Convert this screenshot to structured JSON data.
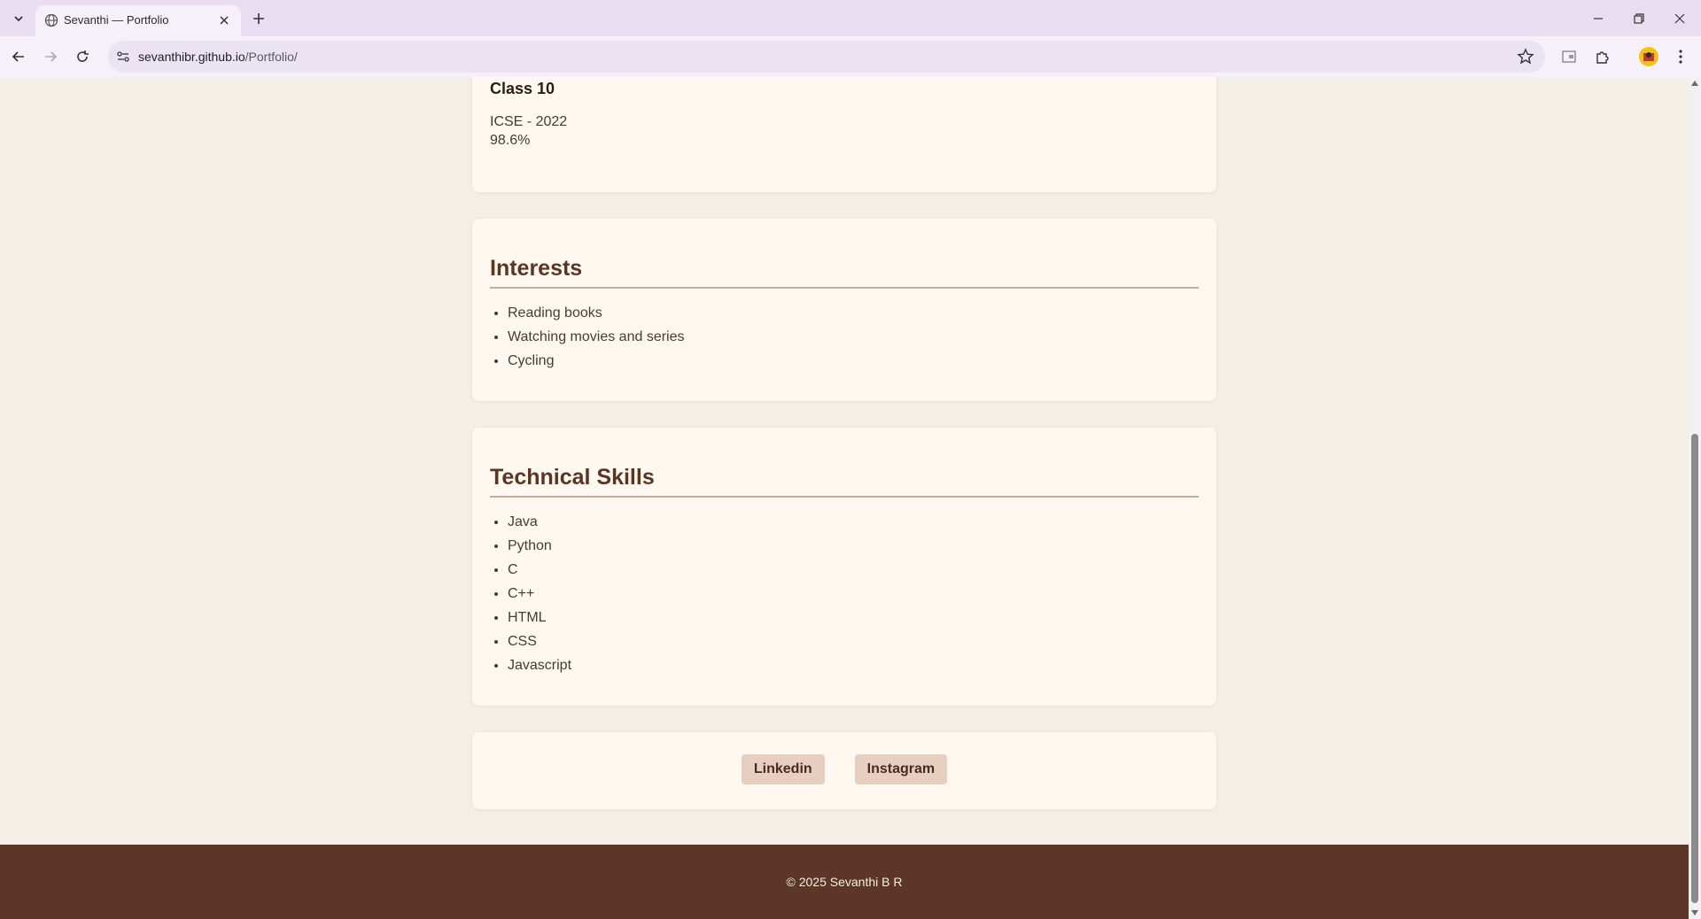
{
  "browser": {
    "tab_title": "Sevanthi — Portfolio",
    "url_host": "sevanthibr.github.io",
    "url_path": "/Portfolio/"
  },
  "education": {
    "class10_title": "Class 10",
    "class10_board": "ICSE - 2022",
    "class10_score": "98.6%"
  },
  "interests": {
    "heading": "Interests",
    "items": [
      "Reading books",
      "Watching movies and series",
      "Cycling"
    ]
  },
  "skills": {
    "heading": "Technical Skills",
    "items": [
      "Java",
      "Python",
      "C",
      "C++",
      "HTML",
      "CSS",
      "Javascript"
    ]
  },
  "social": {
    "linkedin": "Linkedin",
    "instagram": "Instagram"
  },
  "footer": {
    "text": "© 2025 Sevanthi B R"
  },
  "colors": {
    "page_bg": "#f4efe6",
    "card_bg": "#fff8f1",
    "heading_brown": "#5a3524",
    "button_bg": "#e6cfbf",
    "footer_bg": "#5c3626"
  }
}
